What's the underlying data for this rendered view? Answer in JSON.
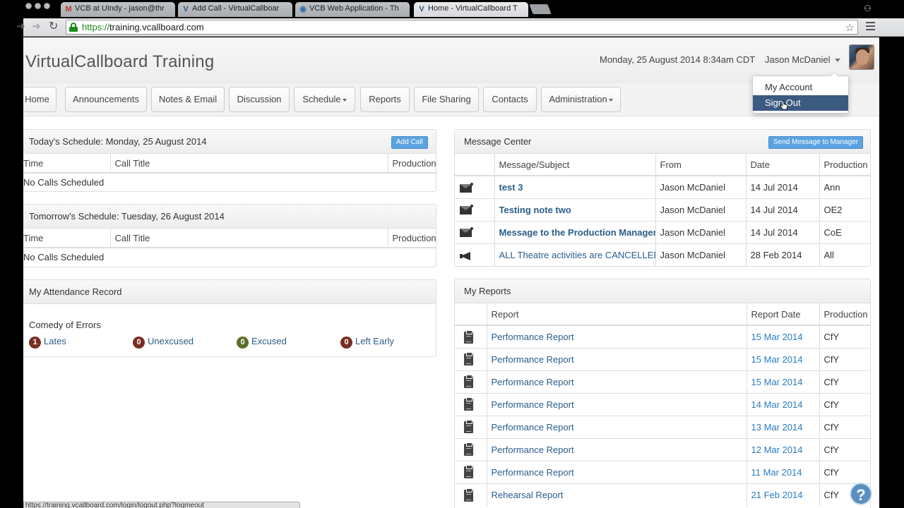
{
  "browser": {
    "tabs": [
      {
        "title": "VCB at UIndy - jason@thr",
        "icon": "gmail-icon"
      },
      {
        "title": "Add Call - VirtualCallboar",
        "icon": "vcb-icon"
      },
      {
        "title": "VCB Web Application - Th",
        "icon": "globe-icon"
      },
      {
        "title": "Home - VirtualCallboard T",
        "icon": "vcb-icon"
      }
    ],
    "url_scheme": "https://",
    "url_host": "training.vcallboard.com",
    "status_url": "https://training.vcallboard.com/login/logout.php?logmeout"
  },
  "header": {
    "site_title": "VirtualCallboard Training",
    "datetime": "Monday, 25 August 2014 8:34am CDT",
    "user_name": "Jason McDaniel"
  },
  "user_menu": {
    "items": [
      "My Account",
      "Sign Out"
    ]
  },
  "nav": {
    "items": [
      "Home",
      "Announcements",
      "Notes & Email",
      "Discussion",
      "Schedule",
      "Reports",
      "File Sharing",
      "Contacts",
      "Administration"
    ]
  },
  "today_schedule": {
    "title": "Today's Schedule: Monday, 25 August 2014",
    "add_call_label": "Add Call",
    "columns": [
      "Time",
      "Call Title",
      "Production"
    ],
    "empty_text": "No Calls Scheduled"
  },
  "tomorrow_schedule": {
    "title": "Tomorrow's Schedule: Tuesday, 26 August 2014",
    "columns": [
      "Time",
      "Call Title",
      "Production"
    ],
    "empty_text": "No Calls Scheduled"
  },
  "attendance": {
    "title": "My Attendance Record",
    "production": "Comedy of Errors",
    "items": [
      {
        "count": "1",
        "label": "Lates",
        "color": "#7a2e22"
      },
      {
        "count": "0",
        "label": "Unexcused",
        "color": "#7a2e22"
      },
      {
        "count": "0",
        "label": "Excused",
        "color": "#5a6f2a"
      },
      {
        "count": "0",
        "label": "Left Early",
        "color": "#7a2e22"
      }
    ]
  },
  "message_center": {
    "title": "Message Center",
    "send_label": "Send Message to Manager",
    "columns": [
      "Message/Subject",
      "From",
      "Date",
      "Production"
    ],
    "rows": [
      {
        "icon": "envelope-icon",
        "subject": "test 3",
        "bold": true,
        "from": "Jason McDaniel",
        "date": "14 Jul 2014",
        "production": "Ann"
      },
      {
        "icon": "envelope-icon",
        "subject": "Testing note two",
        "bold": true,
        "from": "Jason McDaniel",
        "date": "14 Jul 2014",
        "production": "OE2"
      },
      {
        "icon": "envelope-icon",
        "subject": "Message to the Production Manager",
        "bold": true,
        "from": "Jason McDaniel",
        "date": "14 Jul 2014",
        "production": "CoE"
      },
      {
        "icon": "megaphone-icon",
        "subject": "ALL Theatre activities are CANCELLED",
        "bold": false,
        "from": "Jason McDaniel",
        "date": "28 Feb 2014",
        "production": "All"
      }
    ]
  },
  "reports": {
    "title": "My Reports",
    "columns": [
      "Report",
      "Report Date",
      "Production"
    ],
    "rows": [
      {
        "report": "Performance Report",
        "date": "15 Mar 2014",
        "production": "CfY"
      },
      {
        "report": "Performance Report",
        "date": "15 Mar 2014",
        "production": "CfY"
      },
      {
        "report": "Performance Report",
        "date": "15 Mar 2014",
        "production": "CfY"
      },
      {
        "report": "Performance Report",
        "date": "14 Mar 2014",
        "production": "CfY"
      },
      {
        "report": "Performance Report",
        "date": "13 Mar 2014",
        "production": "CfY"
      },
      {
        "report": "Performance Report",
        "date": "12 Mar 2014",
        "production": "CfY"
      },
      {
        "report": "Performance Report",
        "date": "11 Mar 2014",
        "production": "CfY"
      },
      {
        "report": "Rehearsal Report",
        "date": "21 Feb 2014",
        "production": "CfY"
      }
    ]
  },
  "help_label": "?"
}
